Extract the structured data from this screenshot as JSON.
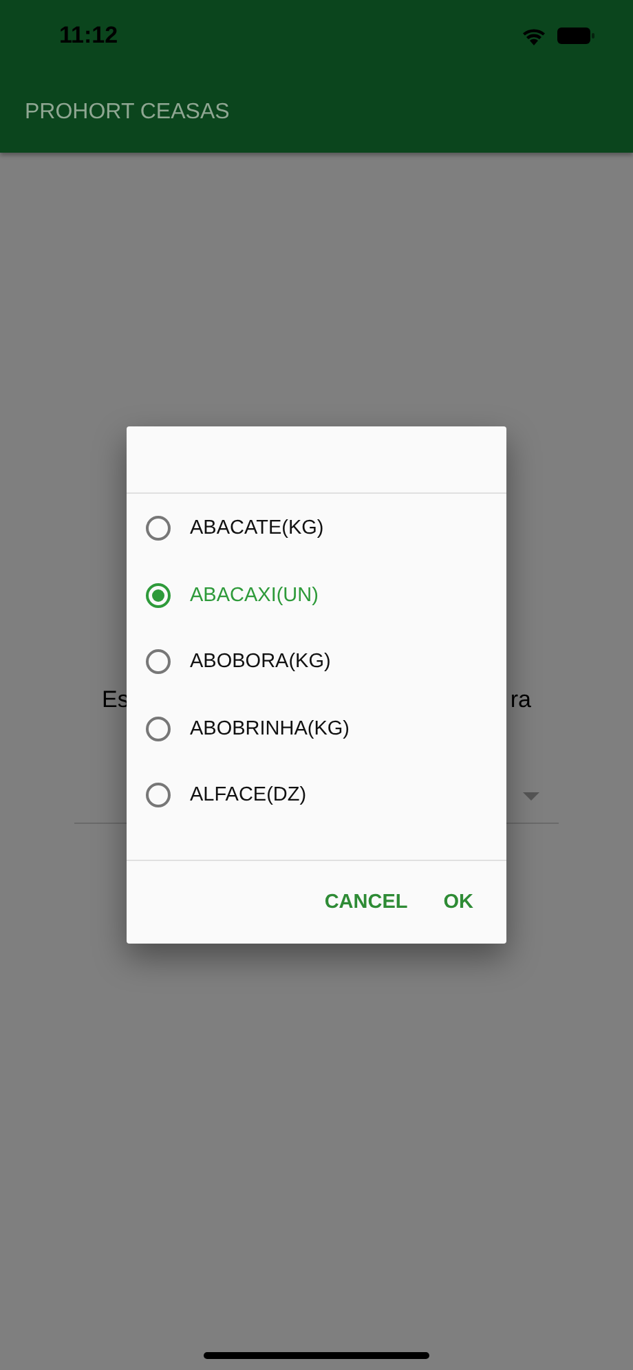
{
  "status_bar": {
    "time": "11:12"
  },
  "app_bar": {
    "title": "PROHORT CEASAS"
  },
  "background": {
    "prompt_start": "Es",
    "prompt_end": "ra"
  },
  "dialog": {
    "options": [
      {
        "label": "ABACATE(KG)",
        "selected": false
      },
      {
        "label": "ABACAXI(UN)",
        "selected": true
      },
      {
        "label": "ABOBORA(KG)",
        "selected": false
      },
      {
        "label": "ABOBRINHA(KG)",
        "selected": false
      },
      {
        "label": "ALFACE(DZ)",
        "selected": false
      }
    ],
    "buttons": [
      "CANCEL",
      "OK"
    ]
  }
}
